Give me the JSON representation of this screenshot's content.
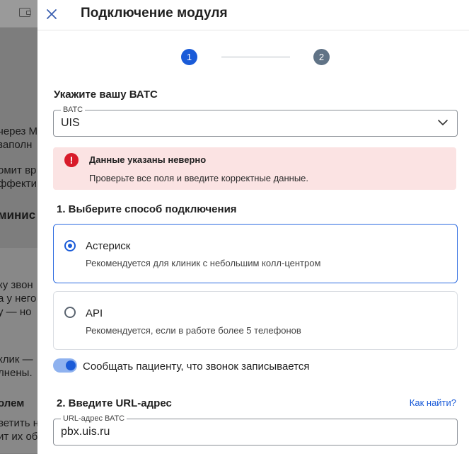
{
  "background": {
    "fragments": [
      "через М",
      "заполн",
      "омит вр",
      "ффектив",
      "минис",
      "ку звон",
      "а у него",
      "у — но",
      "клик —",
      "лнены.",
      "олем",
      "ветить н",
      "ит их об"
    ]
  },
  "dialog": {
    "title": "Подключение модуля",
    "close_icon": "close-icon"
  },
  "stepper": {
    "steps": [
      "1",
      "2"
    ],
    "active": 1
  },
  "pbx": {
    "heading": "Укажите вашу ВАТС",
    "select_label": "ВАТС",
    "select_value": "UIS"
  },
  "error": {
    "title": "Данные указаны неверно",
    "text": "Проверьте все поля и введите корректные данные.",
    "color": "#d81b2a"
  },
  "connection": {
    "heading": "1. Выберите способ подключения",
    "options": [
      {
        "title": "Астериск",
        "desc": "Рекомендуется для клиник с небольшим колл-центром",
        "selected": true
      },
      {
        "title": "API",
        "desc": "Рекомендуется, если в работе более 5 телефонов",
        "selected": false
      }
    ]
  },
  "recording": {
    "label": "Сообщать пациенту, что звонок записывается",
    "enabled": true
  },
  "url": {
    "heading": "2. Введите URL-адрес",
    "help_link": "Как найти?",
    "field_label": "URL-адрес ВАТС",
    "field_value": "pbx.uis.ru"
  },
  "colors": {
    "accent": "#1a5bd8",
    "error_bg": "#fbe3e3"
  }
}
